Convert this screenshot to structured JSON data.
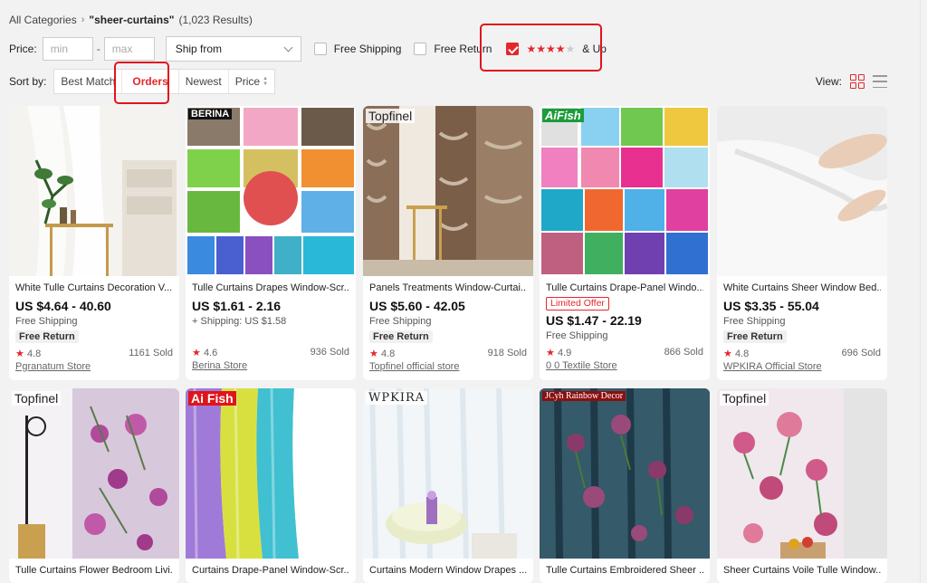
{
  "breadcrumb": {
    "root": "All Categories",
    "separator": "›",
    "query": "\"sheer-curtains\"",
    "results": "(1,023 Results)"
  },
  "filters": {
    "price_label": "Price:",
    "min_placeholder": "min",
    "max_placeholder": "max",
    "dash": "-",
    "ship_from": "Ship from",
    "free_shipping": "Free Shipping",
    "free_return": "Free Return",
    "rating_stars": "★★★★",
    "rating_star_off": "★",
    "rating_suffix": "& Up",
    "rating_checked": true
  },
  "sort": {
    "label": "Sort by:",
    "options": [
      "Best Match",
      "Orders",
      "Newest",
      "Price"
    ],
    "active": "Orders"
  },
  "view": {
    "label": "View:"
  },
  "products": [
    {
      "title": "White Tulle Curtains Decoration V...",
      "price": "US $4.64 - 40.60",
      "shipping": "Free Shipping",
      "tag": "Free Return",
      "rating": "4.8",
      "sold": "1161 Sold",
      "store": "Pgranatum Store"
    },
    {
      "title": "Tulle Curtains Drapes Window-Scr...",
      "price": "US $1.61 - 2.16",
      "shipping": "+ Shipping: US $1.58",
      "rating": "4.6",
      "sold": "936 Sold",
      "store": "Berina Store",
      "brand": "BERINA"
    },
    {
      "title": "Panels Treatments Window-Curtai...",
      "price": "US $5.60 - 42.05",
      "shipping": "Free Shipping",
      "tag": "Free Return",
      "rating": "4.8",
      "sold": "918 Sold",
      "store": "Topfinel official store",
      "brand": "Topfinel"
    },
    {
      "title": "Tulle Curtains Drape-Panel Windo...",
      "badge": "Limited Offer",
      "price": "US $1.47 - 22.19",
      "shipping": "Free Shipping",
      "rating": "4.9",
      "sold": "866 Sold",
      "store": "0 0 Textile Store",
      "brand": "AiFish"
    },
    {
      "title": "White Curtains Sheer Window Bed...",
      "price": "US $3.35 - 55.04",
      "shipping": "Free Shipping",
      "tag": "Free Return",
      "rating": "4.8",
      "sold": "696 Sold",
      "store": "WPKIRA Official Store"
    },
    {
      "title": "Tulle Curtains Flower Bedroom Livi...",
      "brand": "Topfinel"
    },
    {
      "title": "Curtains Drape-Panel Window-Scr...",
      "brand": "Ai Fish"
    },
    {
      "title": "Curtains Modern Window Drapes ...",
      "brand": "WPKIRA"
    },
    {
      "title": "Tulle Curtains Embroidered Sheer ...",
      "brand": "JCyh Rainbow Decor"
    },
    {
      "title": "Sheer Curtains Voile Tulle Window...",
      "brand": "Topfinel"
    }
  ],
  "star_glyph": "★",
  "colors": {
    "accent": "#e4272b",
    "highlight": "#e0141c"
  }
}
